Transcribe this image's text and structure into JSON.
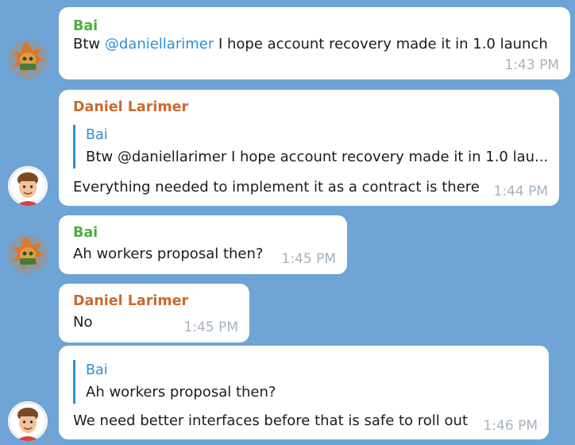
{
  "messages": [
    {
      "sender": "Bai",
      "text_prefix": "Btw ",
      "mention": "@daniellarimer",
      "text_suffix": " I hope account recovery made it in 1.0 launch",
      "time": "1:43 PM"
    },
    {
      "sender": "Daniel Larimer",
      "reply_to": {
        "sender": "Bai",
        "text": "Btw @daniellarimer I hope account recovery made it in 1.0 lau..."
      },
      "text": "Everything needed to implement it as a contract is there",
      "time": "1:44 PM"
    },
    {
      "sender": "Bai",
      "text": "Ah workers proposal then?",
      "time": "1:45 PM"
    },
    {
      "sender": "Daniel Larimer",
      "text": "No",
      "time": "1:45 PM"
    },
    {
      "reply_to": {
        "sender": "Bai",
        "text": "Ah workers proposal then?"
      },
      "text": "We need better interfaces before that is safe to roll out",
      "time": "1:46 PM"
    }
  ],
  "colors": {
    "background": "#6ea4d6",
    "bai_name": "#4caf3f",
    "daniel_name": "#c96b2e",
    "mention": "#2e8fd6",
    "timestamp": "#a7b3bd"
  }
}
